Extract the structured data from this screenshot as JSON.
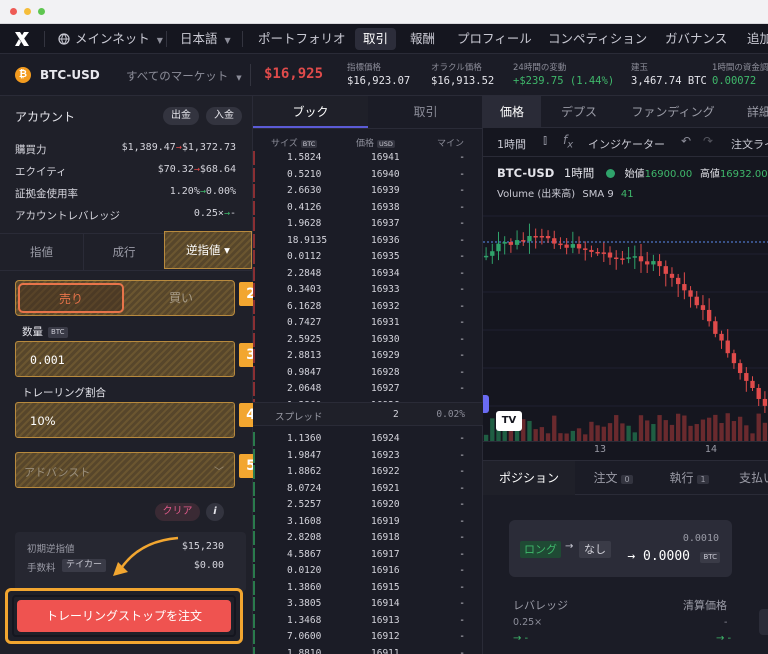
{
  "nav": {
    "network": "メインネット",
    "language": "日本語",
    "items": [
      "ポートフォリオ",
      "取引",
      "報酬",
      "プロフィール",
      "コンペティション",
      "ガバナンス",
      "追加"
    ],
    "active_index": 1
  },
  "market": {
    "symbol": "BTC-USD",
    "all_markets": "すべてのマーケット",
    "price": "$16,925",
    "stats": [
      {
        "label": "指標価格",
        "value": "$16,923.07"
      },
      {
        "label": "オラクル価格",
        "value": "$16,913.52"
      },
      {
        "label": "24時間の変動",
        "value": "+$239.75 (1.44%)"
      },
      {
        "label": "建玉",
        "value": "3,467.74 BTC"
      },
      {
        "label": "1時間の資金調達率",
        "value": "0.00072"
      }
    ]
  },
  "account": {
    "title": "アカウント",
    "withdraw": "出金",
    "deposit": "入金",
    "rows": [
      {
        "label": "購買力",
        "from": "$1,389.47",
        "to": "$1,372.73"
      },
      {
        "label": "エクイティ",
        "from": "$70.32",
        "to": "$68.64"
      },
      {
        "label": "証拠金使用率",
        "from": "1.20%",
        "to": "0.00%"
      },
      {
        "label": "アカウントレバレッジ",
        "from": "0.25×",
        "to": "-"
      }
    ]
  },
  "order": {
    "types": [
      "指値",
      "成行",
      "逆指値 ▾"
    ],
    "side_sell": "売り",
    "side_buy": "買い",
    "qty_label": "数量",
    "qty_unit": "BTC",
    "qty_value": "0.001",
    "trail_label": "トレーリング割合",
    "trail_value": "10%",
    "advanced": "アドバンスト",
    "clear": "クリア",
    "info": "i",
    "summary": [
      {
        "label": "初期逆指値",
        "value": "$15,230"
      },
      {
        "label": "手数料",
        "tag": "テイカー",
        "value": "$0.00"
      }
    ],
    "submit": "トレーリングストップを注文"
  },
  "badges": [
    "1",
    "2",
    "3",
    "4",
    "5"
  ],
  "book": {
    "tabs": [
      "ブック",
      "取引"
    ],
    "col_size": "サイズ",
    "col_size_unit": "BTC",
    "col_price": "価格",
    "col_price_unit": "USD",
    "col_mine": "マイン",
    "asks": [
      [
        "1.5824",
        "16941"
      ],
      [
        "0.5210",
        "16940"
      ],
      [
        "2.6630",
        "16939"
      ],
      [
        "0.4126",
        "16938"
      ],
      [
        "1.9628",
        "16937"
      ],
      [
        "18.9135",
        "16936"
      ],
      [
        "0.0112",
        "16935"
      ],
      [
        "2.2848",
        "16934"
      ],
      [
        "0.3403",
        "16933"
      ],
      [
        "6.1628",
        "16932"
      ],
      [
        "0.7427",
        "16931"
      ],
      [
        "2.5925",
        "16930"
      ],
      [
        "2.8813",
        "16929"
      ],
      [
        "0.9847",
        "16928"
      ],
      [
        "2.0648",
        "16927"
      ],
      [
        "1.3860",
        "16926"
      ]
    ],
    "spread_label": "スプレッド",
    "spread_value": "2",
    "spread_pct": "0.02%",
    "bids": [
      [
        "1.1360",
        "16924"
      ],
      [
        "1.9847",
        "16923"
      ],
      [
        "1.8862",
        "16922"
      ],
      [
        "8.0724",
        "16921"
      ],
      [
        "2.5257",
        "16920"
      ],
      [
        "3.1608",
        "16919"
      ],
      [
        "2.8208",
        "16918"
      ],
      [
        "4.5867",
        "16917"
      ],
      [
        "0.0120",
        "16916"
      ],
      [
        "1.3860",
        "16915"
      ],
      [
        "3.3805",
        "16914"
      ],
      [
        "1.3468",
        "16913"
      ],
      [
        "7.0600",
        "16912"
      ],
      [
        "1.8810",
        "16911"
      ]
    ],
    "mine_placeholder": "-"
  },
  "chart_panel": {
    "tabs": [
      "価格",
      "デプス",
      "ファンディング",
      "詳細"
    ],
    "interval": "1時間",
    "indicators": "インジケーター",
    "order_line": "注文ライン",
    "symbol": "BTC-USD",
    "tf": "1時間",
    "open_label": "始値",
    "open": "16900.00",
    "high_label": "高値",
    "high": "16932.00",
    "volume_label": "Volume (出来高)",
    "sma_label": "SMA 9",
    "sma_value": "41",
    "x_ticks": [
      "13",
      "14"
    ],
    "tv_logo": "TV"
  },
  "positions": {
    "tabs": [
      "ポジション",
      "注文",
      "執行",
      "支払い"
    ],
    "order_count": "0",
    "fill_count": "1",
    "size_from_label": "ロング",
    "size_to_label": "なし",
    "size_small": "0.0010",
    "size_big": "→ 0.0000",
    "size_unit": "BTC",
    "leverage_label": "レバレッジ",
    "liq_label": "清算価格",
    "leverage_value": "0.25×",
    "leverage_to": "→ -",
    "liq_value": "-",
    "liq_to": "→ -"
  },
  "colors": {
    "accent_orange": "#f2a630",
    "red": "#e04b4b",
    "green": "#3fb86b",
    "bg": "#1b1c26"
  }
}
